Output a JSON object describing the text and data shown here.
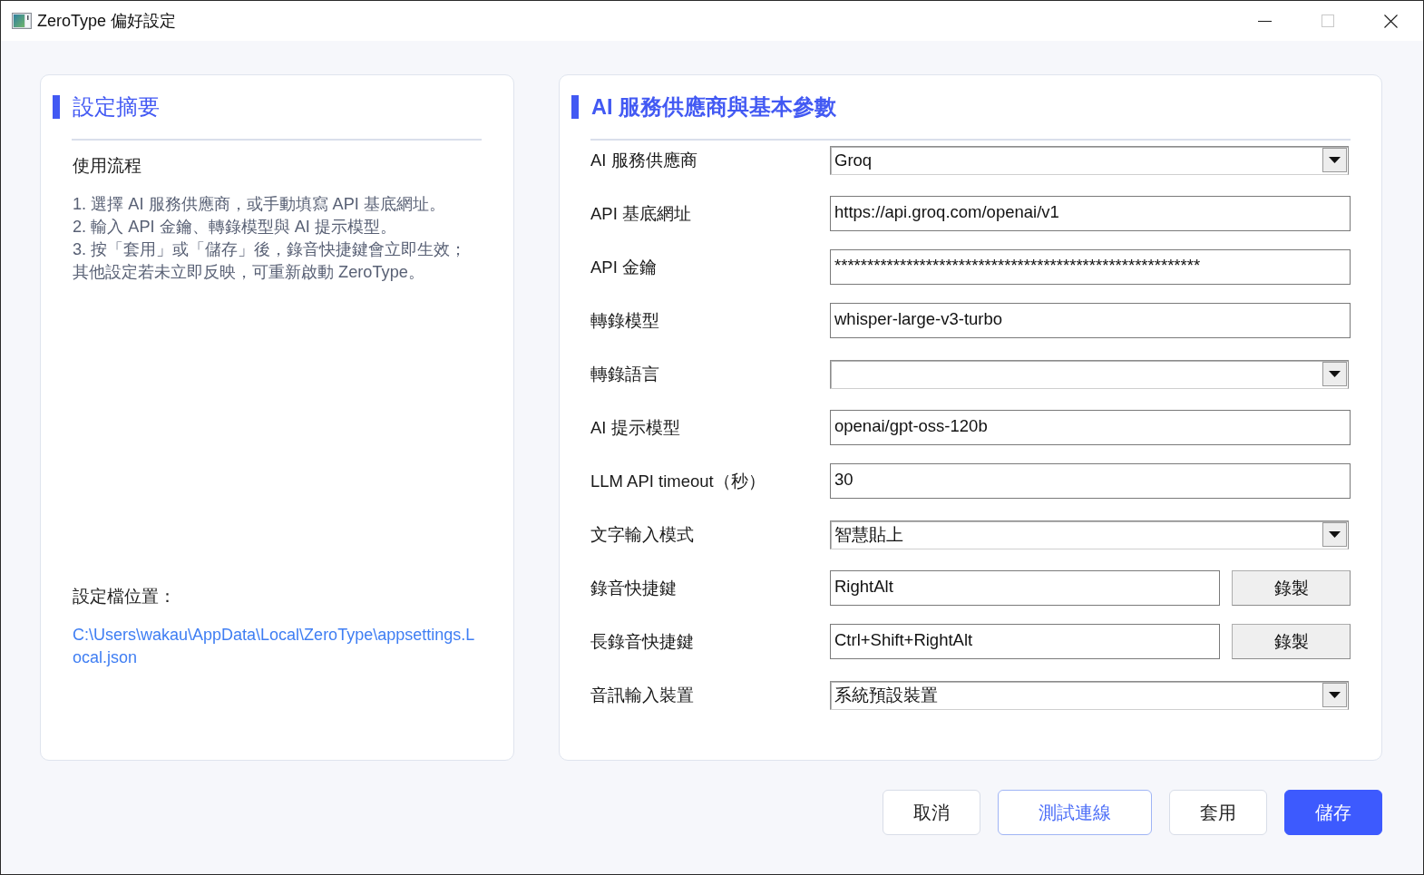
{
  "window": {
    "title": "ZeroType 偏好設定",
    "maximize_disabled": true
  },
  "summary": {
    "title": "設定摘要",
    "subtitle": "使用流程",
    "steps": [
      "1. 選擇 AI 服務供應商，或手動填寫 API 基底網址。",
      "2. 輸入 API 金鑰、轉錄模型與 AI 提示模型。",
      "3. 按「套用」或「儲存」後，錄音快捷鍵會立即生效；其他設定若未立即反映，可重新啟動 ZeroType。"
    ],
    "config_label": "設定檔位置：",
    "config_path": "C:\\Users\\wakau\\AppData\\Local\\ZeroType\\appsettings.Local.json"
  },
  "settings": {
    "title": "AI 服務供應商與基本參數",
    "fields": [
      {
        "kind": "dropdown",
        "label": "AI 服務供應商",
        "value": "Groq"
      },
      {
        "kind": "text",
        "label": "API 基底網址",
        "value": "https://api.groq.com/openai/v1"
      },
      {
        "kind": "text",
        "label": "API 金鑰",
        "value": "********************************************************"
      },
      {
        "kind": "text",
        "label": "轉錄模型",
        "value": "whisper-large-v3-turbo"
      },
      {
        "kind": "dropdown",
        "label": "轉錄語言"
      },
      {
        "kind": "text",
        "label": "AI 提示模型",
        "value": "openai/gpt-oss-120b"
      },
      {
        "kind": "text",
        "label": "LLM API timeout（秒）",
        "value": "30"
      },
      {
        "kind": "dropdown",
        "label": "文字輸入模式",
        "value": "智慧貼上"
      },
      {
        "kind": "hotkey",
        "label": "錄音快捷鍵",
        "value": "RightAlt",
        "button": "錄製"
      },
      {
        "kind": "hotkey",
        "label": "長錄音快捷鍵",
        "value": "Ctrl+Shift+RightAlt",
        "button": "錄製"
      },
      {
        "kind": "dropdown",
        "label": "音訊輸入裝置",
        "value": "系統預設裝置"
      }
    ]
  },
  "buttons": [
    {
      "kind": "plain",
      "label": "取消"
    },
    {
      "kind": "outline",
      "label": "測試連線"
    },
    {
      "kind": "plain",
      "label": "套用"
    },
    {
      "kind": "primary",
      "label": "儲存"
    }
  ]
}
